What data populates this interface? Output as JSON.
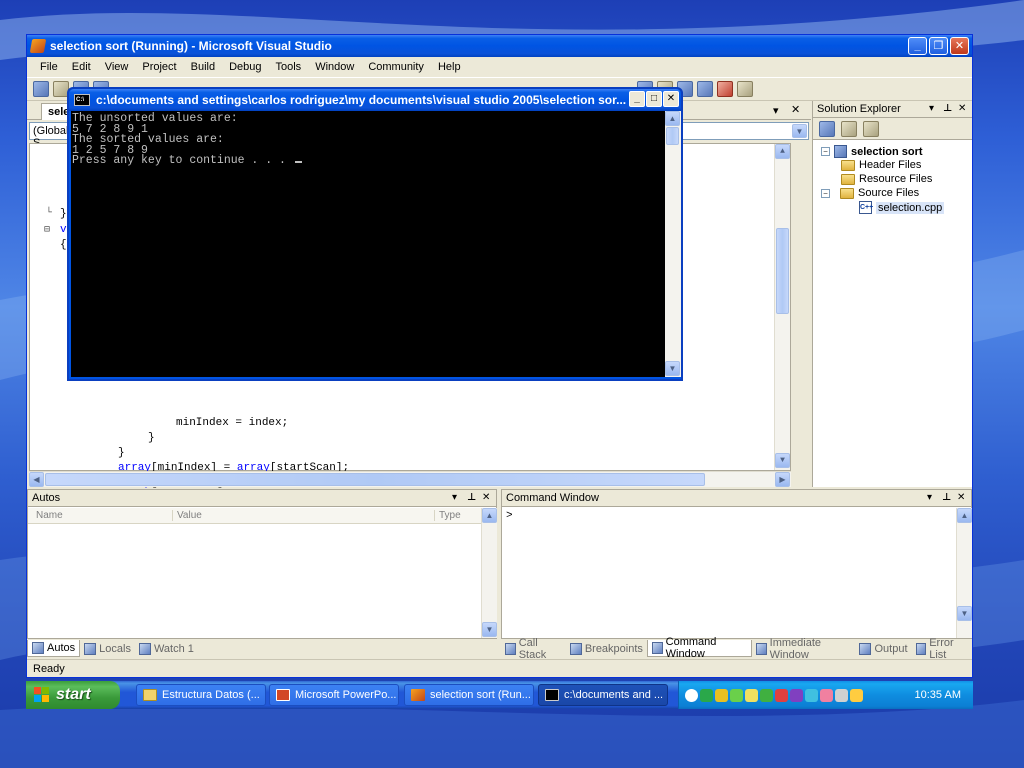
{
  "vs": {
    "title": "selection sort (Running) - Microsoft Visual Studio",
    "menu": [
      "File",
      "Edit",
      "View",
      "Project",
      "Build",
      "Debug",
      "Tools",
      "Window",
      "Community",
      "Help"
    ],
    "editor_tab": "selec",
    "scope_dropdown": "(Global S",
    "code_lines": {
      "l1": "minIndex = index;",
      "l2": "}",
      "l3": "}",
      "l4_kw": "array",
      "l4_rest": "[minIndex] = ",
      "l4_kw2": "array",
      "l4_end": "[startScan];",
      "l5_kw": "array",
      "l5_rest": "[startScan] = minValue;",
      "l6": "}",
      "frag_brace": "}",
      "frag_vo": "vo",
      "frag_open": "{"
    },
    "solution_explorer": {
      "title": "Solution Explorer",
      "root": "selection sort",
      "items": [
        "Header Files",
        "Resource Files",
        "Source Files"
      ],
      "file": "selection.cpp"
    },
    "autos": {
      "title": "Autos",
      "col_name": "Name",
      "col_value": "Value",
      "col_type": "Type"
    },
    "command_window": {
      "title": "Command Window",
      "prompt": ">"
    },
    "left_tabs": [
      "Autos",
      "Locals",
      "Watch 1"
    ],
    "right_tabs": [
      "Call Stack",
      "Breakpoints",
      "Command Window",
      "Immediate Window",
      "Output",
      "Error List"
    ],
    "status": "Ready"
  },
  "console": {
    "title": "c:\\documents and settings\\carlos rodriguez\\my documents\\visual studio 2005\\selection sor...",
    "icon_text": "C:\\",
    "lines": [
      "The unsorted values are:",
      "5 7 2 8 9 1",
      "The sorted values are:",
      "1 2 5 7 8 9",
      "Press any key to continue . . . "
    ]
  },
  "taskbar": {
    "start": "start",
    "tasks": [
      "Estructura Datos (...",
      "Microsoft PowerPo...",
      "selection sort (Run...",
      "c:\\documents and ..."
    ],
    "clock": "10:35 AM"
  }
}
